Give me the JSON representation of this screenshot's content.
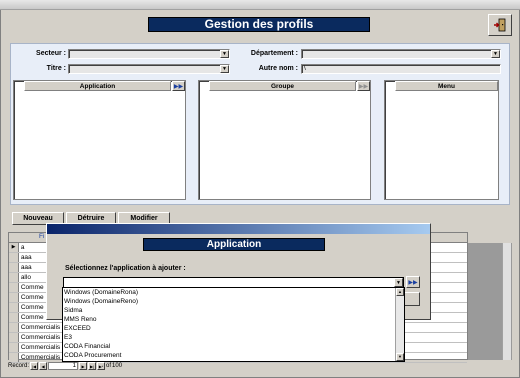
{
  "header": {
    "title": "Gestion des profils"
  },
  "filters": {
    "secteur_label": "Secteur :",
    "secteur_value": "",
    "departement_label": "Département :",
    "departement_value": "",
    "titre_label": "Titre :",
    "titre_value": "",
    "autre_nom_label": "Autre nom :",
    "autre_nom_value": "\\"
  },
  "lists": {
    "application_header": "Application",
    "groupe_header": "Groupe",
    "menu_header": "Menu"
  },
  "actions": {
    "nouveau": "Nouveau",
    "detruire": "Détruire",
    "modifier": "Modifier"
  },
  "grid": {
    "header_partial": "Fi",
    "rows": [
      "a",
      "aaa",
      "aaa",
      "allo",
      "Comme",
      "Comme",
      "Comme",
      "Comme",
      "Commercialis",
      "Commercialis",
      "Commercialis",
      "Commercialis"
    ]
  },
  "navigation": {
    "record_label": "Record:",
    "current": "1",
    "of_label": "of",
    "total": "100"
  },
  "dialog": {
    "title": "Application",
    "prompt": "Sélectionnez l'application à ajouter :",
    "select_value": "",
    "options": [
      "Windows (DomaineRona)",
      "Windows (DomaineReno)",
      "Sidma",
      "MMS Reno",
      "EXCEED",
      "E3",
      "CODA Financial",
      "CODA Procurement"
    ]
  },
  "colors": {
    "banner": "#0a2a5e",
    "panel": "#e8eef8",
    "window": "#d4d0c8",
    "titlebar_start": "#0a246a"
  },
  "icons": {
    "exit": "exit-door-icon",
    "add": "double-arrow-right-icon",
    "dropdown": "chevron-down-icon"
  }
}
